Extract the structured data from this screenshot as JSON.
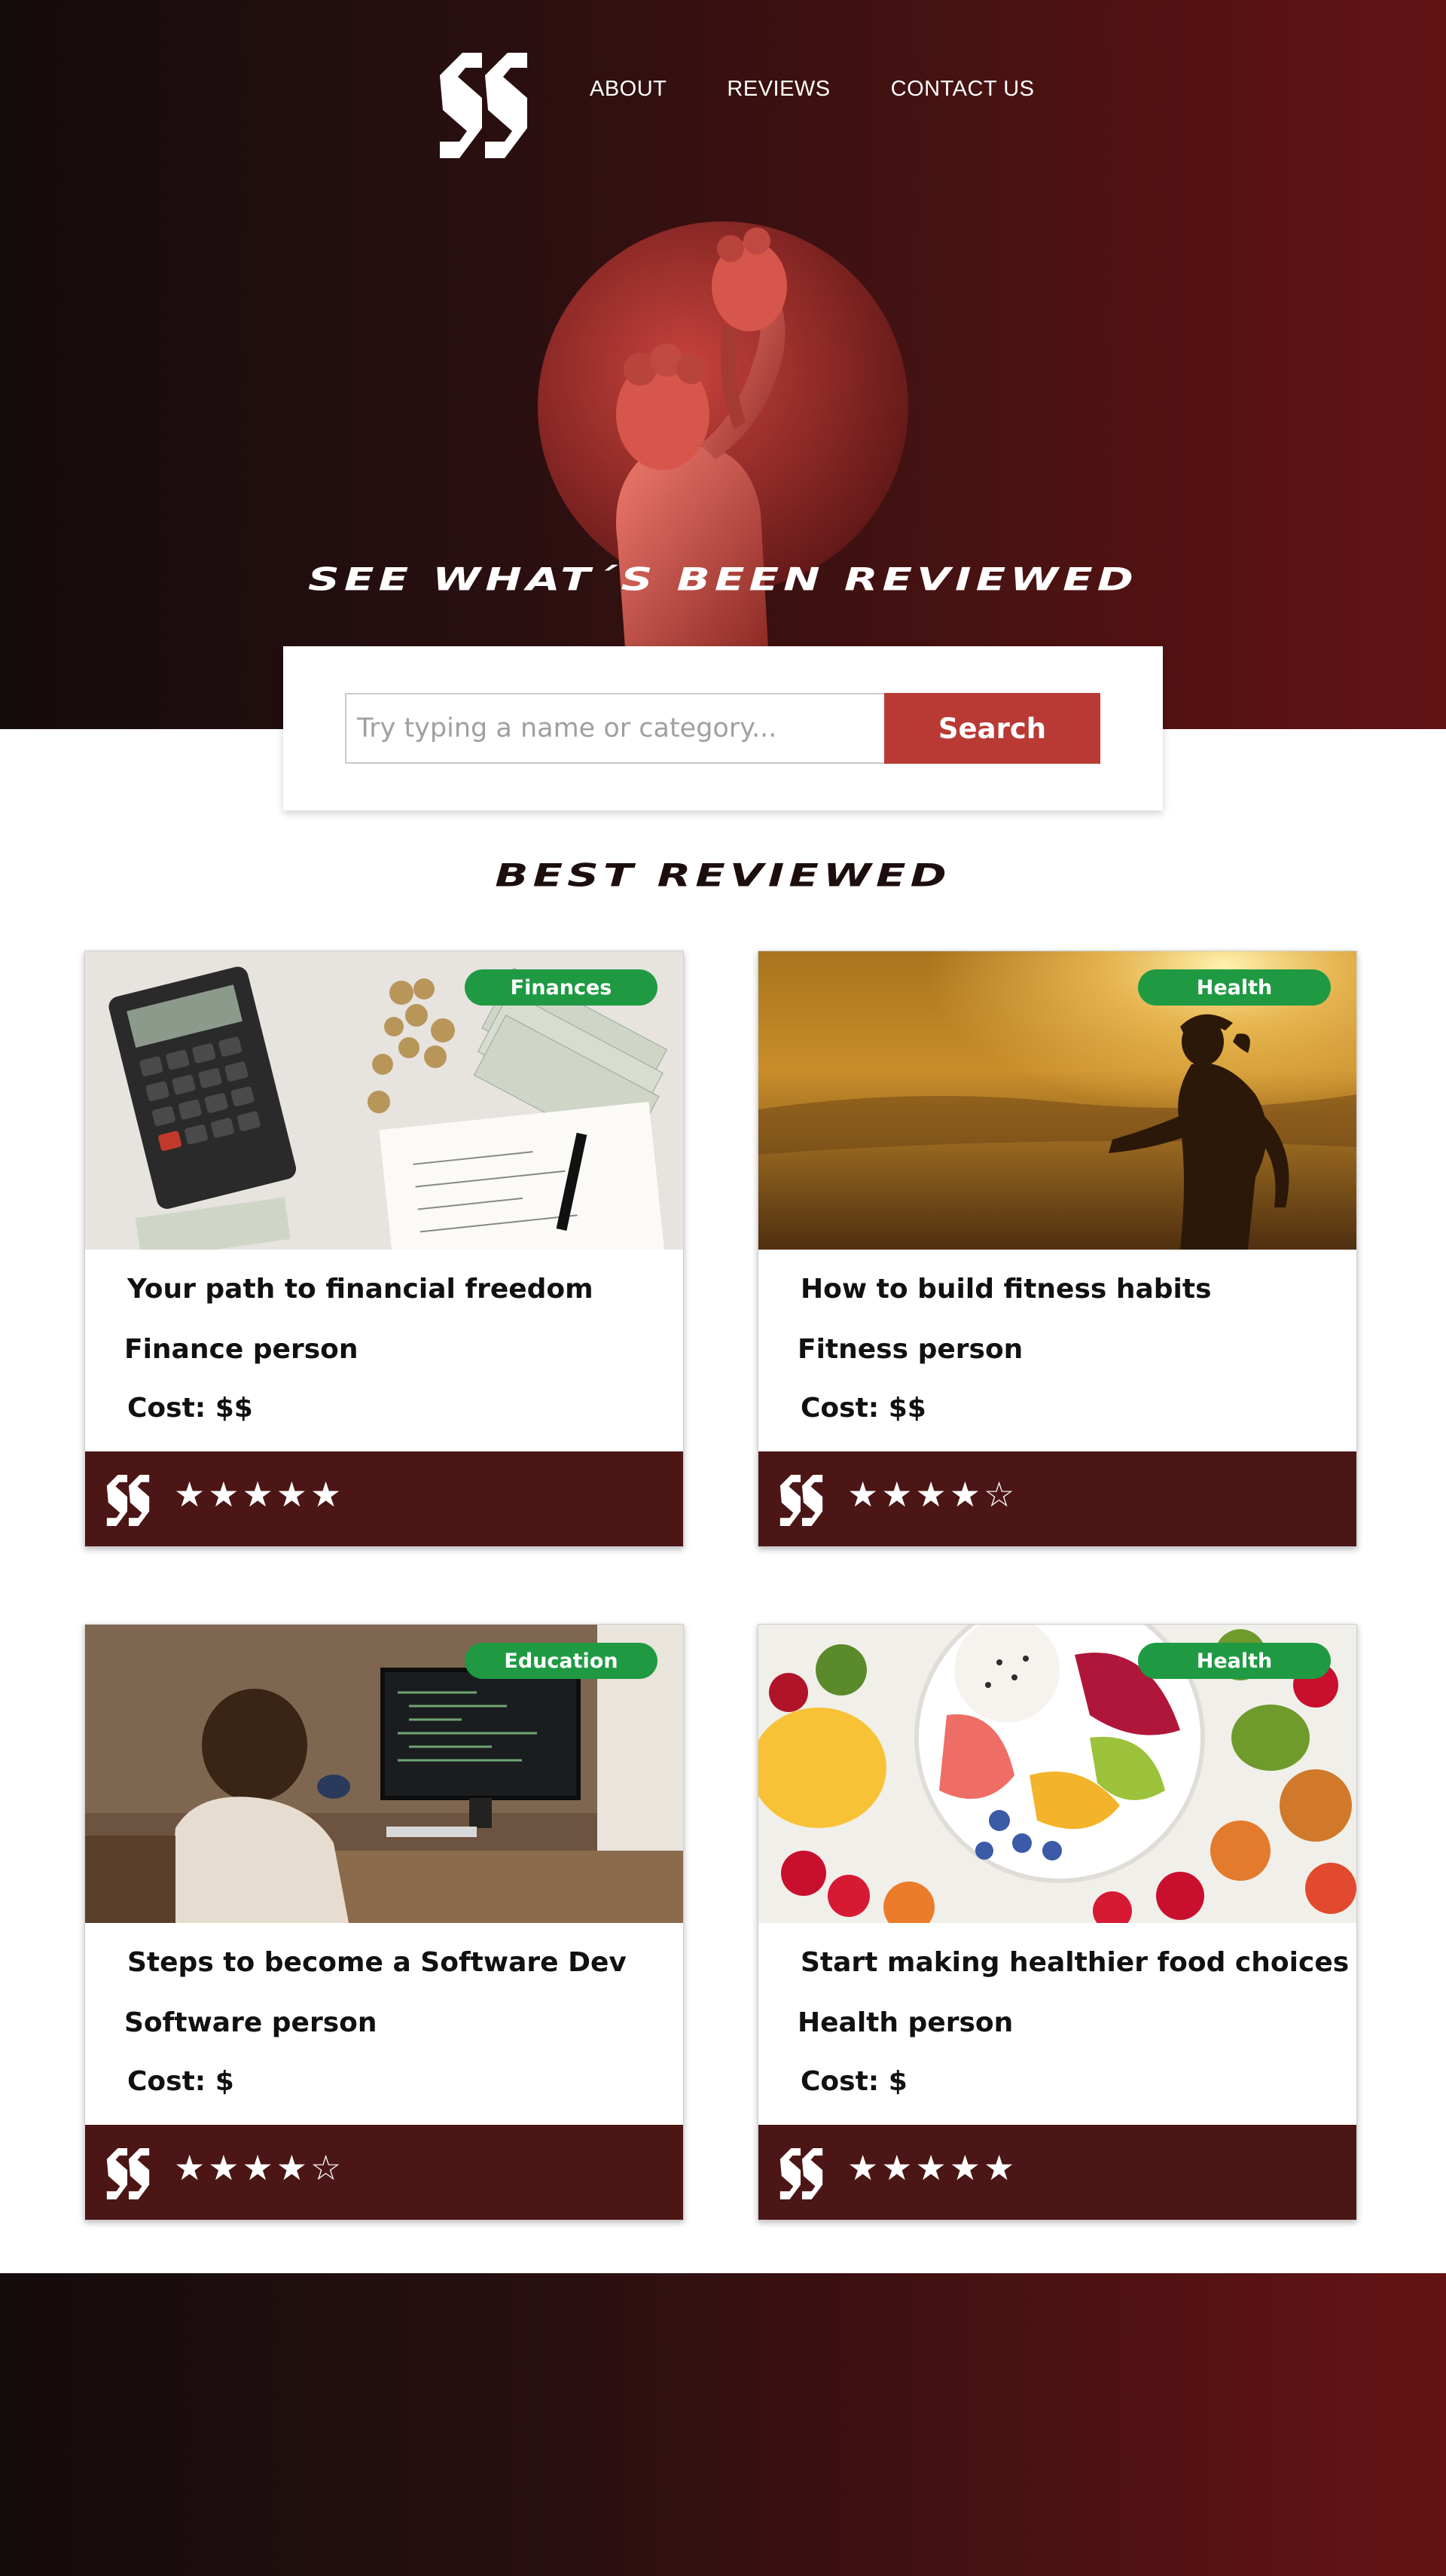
{
  "nav": {
    "items": [
      "ABOUT",
      "REVIEWS",
      "CONTACT US"
    ]
  },
  "hero": {
    "title": "SEE WHAT´S BEEN REVIEWED"
  },
  "search": {
    "placeholder": "Try typing a name or category...",
    "button_label": "Search"
  },
  "section": {
    "title": "BEST REVIEWED"
  },
  "cards": [
    {
      "category": "Finances",
      "title": "Your path to financial freedom",
      "author": "Finance person",
      "cost": "Cost: $$",
      "rating": 5,
      "stars": "★★★★★",
      "image_icon": "calculator-money-photo"
    },
    {
      "category": "Health",
      "title": "How to build fitness habits",
      "author": "Fitness person",
      "cost": "Cost: $$",
      "rating": 4,
      "stars": "★★★★☆",
      "image_icon": "runner-sunset-photo"
    },
    {
      "category": "Education",
      "title": "Steps to become a Software Dev",
      "author": "Software person",
      "cost": "Cost: $",
      "rating": 4,
      "stars": "★★★★☆",
      "image_icon": "developer-desk-photo"
    },
    {
      "category": "Health",
      "title": "Start making healthier food choices",
      "author": "Health person",
      "cost": "Cost: $",
      "rating": 5,
      "stars": "★★★★★",
      "image_icon": "fruit-bowl-photo"
    }
  ],
  "colors": {
    "accent": "#b93a35",
    "badge": "#1f9a43",
    "card_footer": "#4b1615",
    "hero_dark": "#140c0d",
    "hero_red": "#621314"
  }
}
